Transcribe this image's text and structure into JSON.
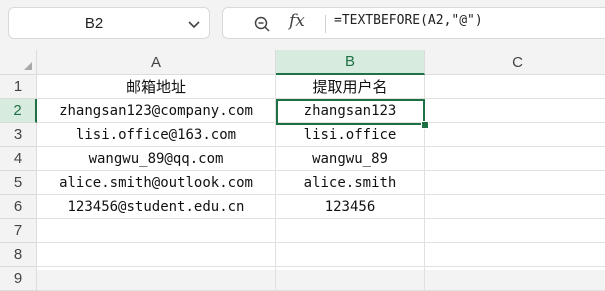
{
  "name_box": {
    "ref": "B2"
  },
  "formula_bar": {
    "fx_label": "fx",
    "formula": "=TEXTBEFORE(A2,\"@\")"
  },
  "columns": [
    "A",
    "B",
    "C"
  ],
  "rows": [
    "1",
    "2",
    "3",
    "4",
    "5",
    "6",
    "7",
    "8",
    "9"
  ],
  "cells": {
    "A1": "邮箱地址",
    "B1": "提取用户名",
    "A2": "zhangsan123@company.com",
    "B2": "zhangsan123",
    "A3": "lisi.office@163.com",
    "B3": "lisi.office",
    "A4": "wangwu_89@qq.com",
    "B4": "wangwu_89",
    "A5": "alice.smith@outlook.com",
    "B5": "alice.smith",
    "A6": "123456@student.edu.cn",
    "B6": "123456"
  },
  "selection": {
    "cell": "B2",
    "accent_color": "#1e7145"
  }
}
